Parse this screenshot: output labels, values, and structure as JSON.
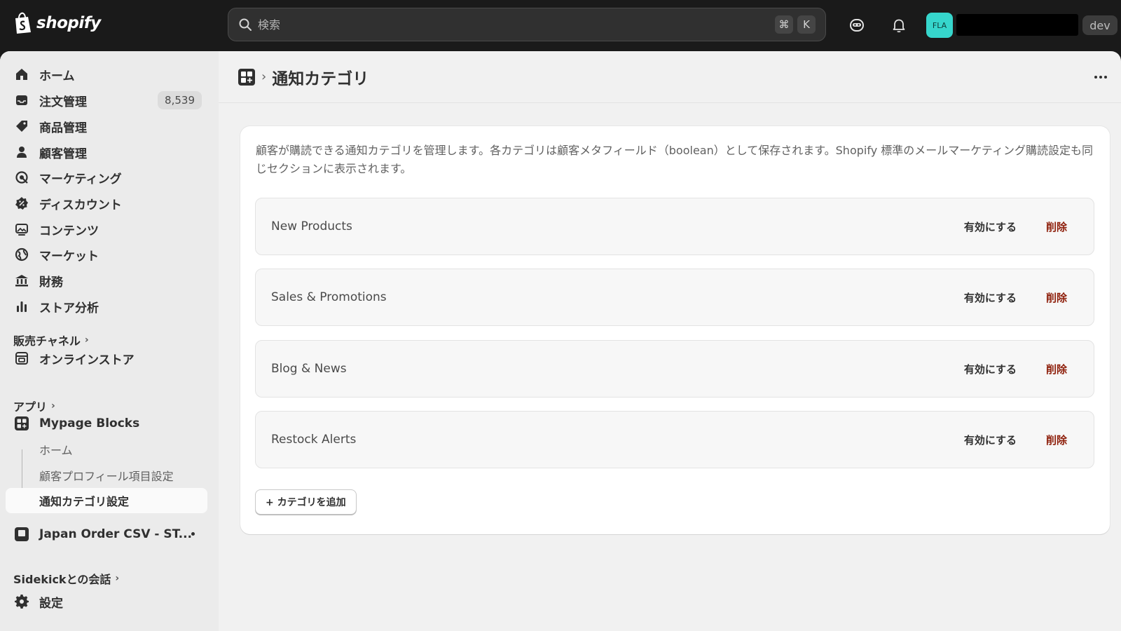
{
  "topbar": {
    "logo_text": "shopify",
    "search_placeholder": "検索",
    "shortcut_cmd": "⌘",
    "shortcut_key": "K",
    "avatar_initials": "FLA",
    "dev_badge": "dev",
    "avatar_color": "#36d6cc"
  },
  "sidebar": {
    "items": [
      {
        "label": "ホーム",
        "icon": "home-icon"
      },
      {
        "label": "注文管理",
        "icon": "inbox-icon",
        "badge": "8,539"
      },
      {
        "label": "商品管理",
        "icon": "tag-icon"
      },
      {
        "label": "顧客管理",
        "icon": "person-icon"
      },
      {
        "label": "マーケティング",
        "icon": "target-icon"
      },
      {
        "label": "ディスカウント",
        "icon": "discount-icon"
      },
      {
        "label": "コンテンツ",
        "icon": "image-icon"
      },
      {
        "label": "マーケット",
        "icon": "globe-icon"
      },
      {
        "label": "財務",
        "icon": "bank-icon"
      },
      {
        "label": "ストア分析",
        "icon": "bar-chart-icon"
      }
    ],
    "sales_channels_label": "販売チャネル",
    "online_store_label": "オンラインストア",
    "apps_label": "アプリ",
    "app_name": "Mypage Blocks",
    "app_sub_items": [
      "ホーム",
      "顧客プロフィール項目設定",
      "通知カテゴリ設定"
    ],
    "other_app": "Japan Order CSV - ST...",
    "sidekick_label": "Sidekickとの会話",
    "settings_label": "設定"
  },
  "main": {
    "breadcrumb_sep": "›",
    "title": "通知カテゴリ",
    "description": "顧客が購読できる通知カテゴリを管理します。各カテゴリは顧客メタフィールド（boolean）として保存されます。Shopify 標準のメールマーケティング購読設定も同じセクションに表示されます。",
    "categories": [
      {
        "name": "New Products",
        "enable_label": "有効にする",
        "delete_label": "削除"
      },
      {
        "name": "Sales & Promotions",
        "enable_label": "有効にする",
        "delete_label": "削除"
      },
      {
        "name": "Blog & News",
        "enable_label": "有効にする",
        "delete_label": "削除"
      },
      {
        "name": "Restock Alerts",
        "enable_label": "有効にする",
        "delete_label": "削除"
      }
    ],
    "add_button": "+ カテゴリを追加",
    "delete_color": "#8e1f0b"
  }
}
